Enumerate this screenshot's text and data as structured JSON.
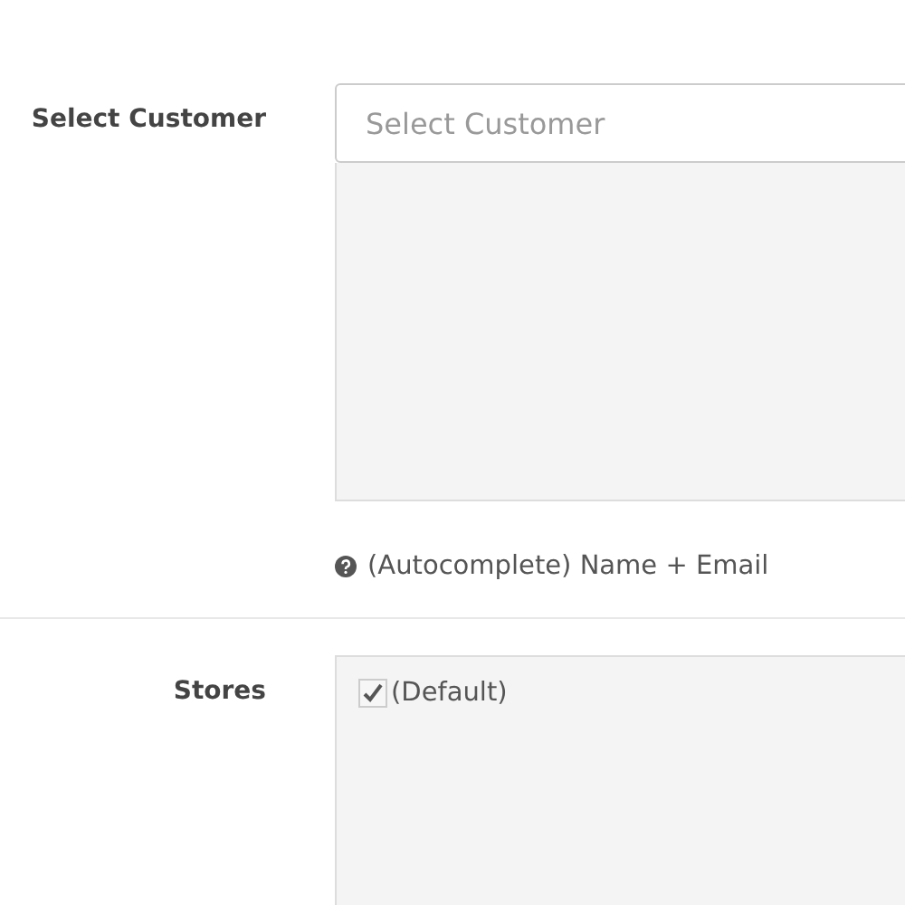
{
  "customer": {
    "label": "Select Customer",
    "placeholder": "Select Customer",
    "help": "(Autocomplete) Name + Email"
  },
  "stores": {
    "label": "Stores",
    "items": [
      {
        "label": "(Default)",
        "checked": true
      }
    ]
  }
}
